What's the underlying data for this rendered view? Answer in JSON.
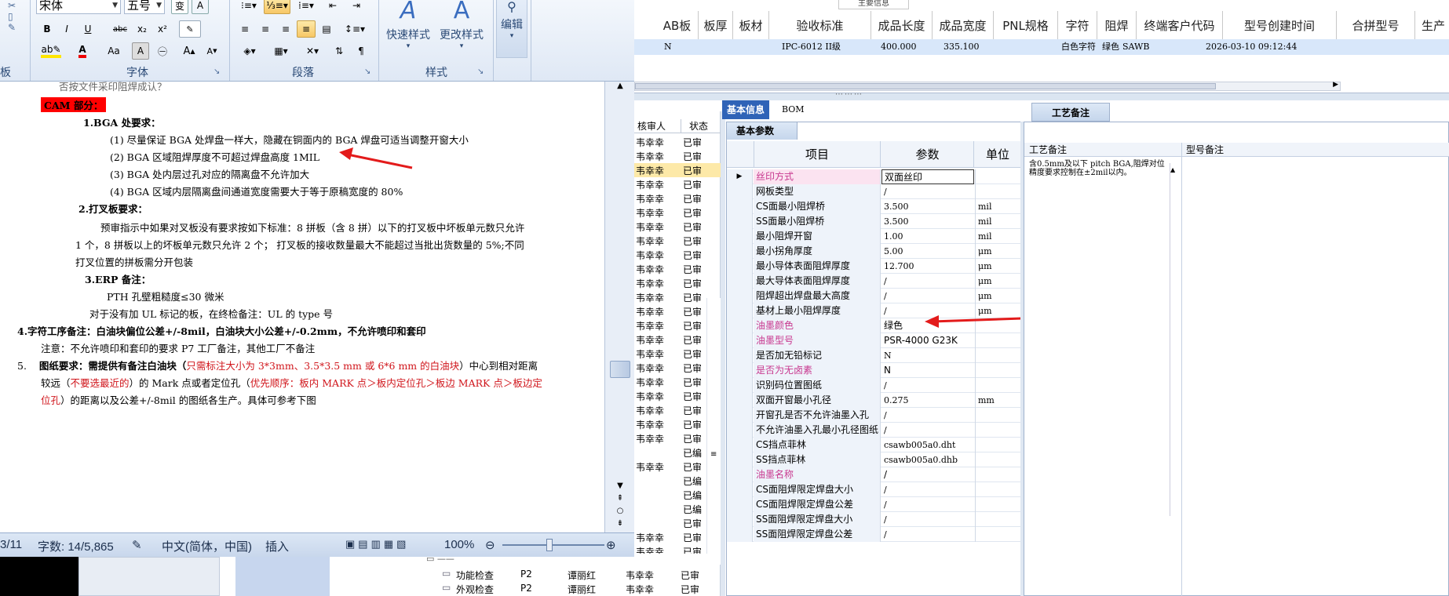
{
  "ribbon": {
    "font_name": "宋体",
    "font_size": "五号",
    "groups": {
      "font": "字体",
      "paragraph": "段落",
      "styles": "样式"
    },
    "quick_styles": "快速样式",
    "change_styles": "更改样式",
    "edit": "编辑",
    "bold": "B",
    "italic": "I",
    "underline": "U",
    "strike": "abc",
    "sub": "x₂",
    "sup": "x²",
    "font_a": "A",
    "aa": "Aa",
    "grow": "A",
    "shrink": "A"
  },
  "doc": {
    "l0": "否按文件采印阻焊成认？",
    "l1": "CAM 部分：",
    "l2": "1.BGA 处要求：",
    "l3": "(1)  尽量保证 BGA 处焊盘一样大，隐藏在铜面内的 BGA 焊盘可适当调整开窗大小",
    "l4": "(2)  BGA 区域阻焊厚度不可超过焊盘高度 1MIL",
    "l5": "(3)  BGA 处内层过孔对应的隔离盘不允许加大",
    "l6": "(4)  BGA 区域内层隔离盘间通道宽度需要大于等于原稿宽度的 80%",
    "l7": "2.打叉板要求：",
    "l8": "预审指示中如果对叉板没有要求按如下标准：8 拼板（含 8 拼）以下的打叉板中坏板单元数只允许",
    "l9": "1 个，8 拼板以上的坏板单元数只允许 2 个； 打叉板的接收数量最大不能超过当批出货数量的 5%;不同",
    "l10": "打叉位置的拼板需分开包装",
    "l11": "3.ERP 备注：",
    "l12": "PTH 孔壁粗糙度≤30 微米",
    "l13": "对于没有加 UL 标记的板，在终检备注：UL 的 type 号",
    "l14": "4.字符工序备注：白油块偏位公差+/-8mil，白油块大小公差+/-0.2mm，不允许喷印和套印",
    "l15": "注意：不允许喷印和套印的要求 P7 工厂备注，其他工厂不备注",
    "l16a": "5.",
    "l16b": "图纸要求：需提供有备注白油块（",
    "l16c": "只需标注大小为 3*3mm、3.5*3.5 mm 或 6*6 mm 的白油块",
    "l16d": "）中心到相对距离",
    "l17a": "较远（",
    "l17b": "不要选最近的",
    "l17c": "）的 Mark 点或者定位孔（",
    "l17d": "优先顺序：板内 MARK 点＞板内定位孔＞板边 MARK 点＞板边定",
    "l18a": "位孔",
    "l18b": "）的距离以及公差+/-8mil 的图纸各生产。具体可参考下图"
  },
  "status": {
    "page": "3/11",
    "words": "字数: 14/5,865",
    "lang": "中文(简体，中国)",
    "mode": "插入",
    "zoom": "100%"
  },
  "grid": {
    "group_header": "主要信息",
    "headers": [
      "AB板",
      "板厚",
      "板材",
      "验收标准",
      "成品长度",
      "成品宽度",
      "PNL规格",
      "字符",
      "阻焊",
      "终端客户代码",
      "型号创建时间",
      "合拼型号",
      "生产"
    ],
    "row": {
      "ab": "N",
      "std": "IPC-6012 II级",
      "len": "400.000",
      "wid": "335.100",
      "char": "白色字符",
      "mask": "绿色",
      "cust": "SAWB",
      "time": "2026-03-10 09:12:44"
    }
  },
  "midlist": {
    "col1": "核审人",
    "col2": "状态",
    "rows": [
      {
        "a": "韦幸幸",
        "b": "已审"
      },
      {
        "a": "韦幸幸",
        "b": "已审"
      },
      {
        "a": "韦幸幸",
        "b": "已审"
      },
      {
        "a": "韦幸幸",
        "b": "已审"
      },
      {
        "a": "韦幸幸",
        "b": "已审"
      },
      {
        "a": "韦幸幸",
        "b": "已审"
      },
      {
        "a": "韦幸幸",
        "b": "已审"
      },
      {
        "a": "韦幸幸",
        "b": "已审"
      },
      {
        "a": "韦幸幸",
        "b": "已审"
      },
      {
        "a": "韦幸幸",
        "b": "已审"
      },
      {
        "a": "韦幸幸",
        "b": "已审"
      },
      {
        "a": "韦幸幸",
        "b": "已审"
      },
      {
        "a": "韦幸幸",
        "b": "已审"
      },
      {
        "a": "韦幸幸",
        "b": "已审"
      },
      {
        "a": "韦幸幸",
        "b": "已审"
      },
      {
        "a": "韦幸幸",
        "b": "已审"
      },
      {
        "a": "韦幸幸",
        "b": "已审"
      },
      {
        "a": "韦幸幸",
        "b": "已审"
      },
      {
        "a": "韦幸幸",
        "b": "已审"
      },
      {
        "a": "韦幸幸",
        "b": "已审"
      },
      {
        "a": "韦幸幸",
        "b": "已审"
      },
      {
        "a": "韦幸幸",
        "b": "已审"
      },
      {
        "a": "",
        "b": "已编"
      },
      {
        "a": "韦幸幸",
        "b": "已审"
      },
      {
        "a": "",
        "b": "已编"
      },
      {
        "a": "",
        "b": "已编"
      },
      {
        "a": "",
        "b": "已编"
      },
      {
        "a": "",
        "b": "已审"
      },
      {
        "a": "韦幸幸",
        "b": "已审"
      },
      {
        "a": "韦幸幸",
        "b": "已审"
      },
      {
        "a": "韦幸幸",
        "b": "已审"
      },
      {
        "a": "韦幸幸",
        "b": "已审"
      }
    ],
    "tree": [
      {
        "name": "功能检查",
        "pr": "P2",
        "who": "谭丽红",
        "rev": "韦幸幸",
        "st": "已审"
      },
      {
        "name": "外观检查",
        "pr": "P2",
        "who": "谭丽红",
        "rev": "韦幸幸",
        "st": "已审"
      }
    ]
  },
  "params": {
    "tab_basic": "基本信息",
    "tab_bom": "BOM",
    "sub_tab": "基本参数",
    "head": {
      "item": "项目",
      "value": "参数",
      "unit": "单位"
    },
    "rows": [
      {
        "k": "丝印方式",
        "v": "双面丝印",
        "u": "",
        "pink": true
      },
      {
        "k": "网板类型",
        "v": "/",
        "u": ""
      },
      {
        "k": "CS面最小阻焊桥",
        "v": "3.500",
        "u": "mil"
      },
      {
        "k": "SS面最小阻焊桥",
        "v": "3.500",
        "u": "mil"
      },
      {
        "k": "最小阻焊开窗",
        "v": "1.00",
        "u": "mil"
      },
      {
        "k": "最小拐角厚度",
        "v": "5.00",
        "u": "μm"
      },
      {
        "k": "最小导体表面阻焊厚度",
        "v": "12.700",
        "u": "μm"
      },
      {
        "k": "最大导体表面阻焊厚度",
        "v": "/",
        "u": "μm"
      },
      {
        "k": "阻焊超出焊盘最大高度",
        "v": "/",
        "u": "μm"
      },
      {
        "k": "基材上最小阻焊厚度",
        "v": "/",
        "u": "μm"
      },
      {
        "k": "油墨颜色",
        "v": "绿色",
        "u": "",
        "pink": true
      },
      {
        "k": "油墨型号",
        "v": "PSR-4000 G23K",
        "u": "",
        "pink": true
      },
      {
        "k": "是否加无铅标记",
        "v": "N",
        "u": ""
      },
      {
        "k": "是否为无卤素",
        "v": "N",
        "u": "",
        "pink": true
      },
      {
        "k": "识别码位置图纸",
        "v": "/",
        "u": ""
      },
      {
        "k": "双面开窗最小孔径",
        "v": "0.275",
        "u": "mm"
      },
      {
        "k": "开窗孔是否不允许油墨入孔",
        "v": "/",
        "u": ""
      },
      {
        "k": "不允许油墨入孔最小孔径图纸",
        "v": "/",
        "u": ""
      },
      {
        "k": "CS挡点菲林",
        "v": "csawb005a0.dht",
        "u": ""
      },
      {
        "k": "SS挡点菲林",
        "v": "csawb005a0.dhb",
        "u": ""
      },
      {
        "k": "油墨名称",
        "v": "/",
        "u": "",
        "pink": true
      },
      {
        "k": "CS面阻焊限定焊盘大小",
        "v": "/",
        "u": ""
      },
      {
        "k": "CS面阻焊限定焊盘公差",
        "v": "/",
        "u": ""
      },
      {
        "k": "SS面阻焊限定焊盘大小",
        "v": "/",
        "u": ""
      },
      {
        "k": "SS面阻焊限定焊盘公差",
        "v": "/",
        "u": ""
      }
    ]
  },
  "craft": {
    "tab": "工艺备注",
    "col1": "工艺备注",
    "col2": "型号备注",
    "note": "含0.5mm及以下 pitch BGA,阻焊对位精度要求控制在±2mil以内。"
  },
  "colors": {
    "accent": "#2f63b7",
    "arrow": "#e31b1b",
    "pink": "#c8388f",
    "selected_row": "#d8e7fa",
    "red_text": "#d0151b"
  }
}
